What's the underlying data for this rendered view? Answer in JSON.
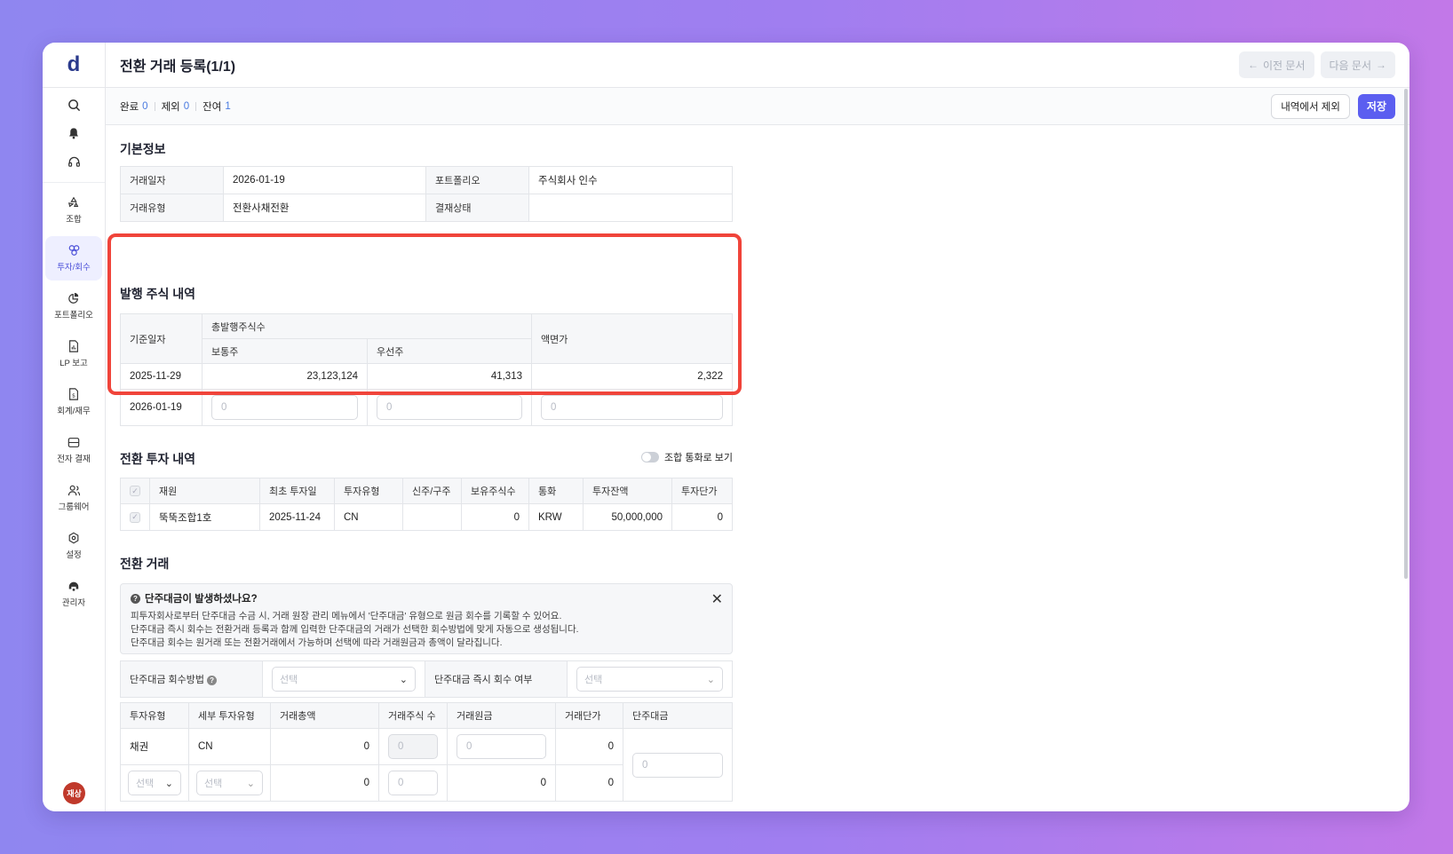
{
  "sidebar": {
    "logo": "d",
    "items": [
      {
        "label": "조합",
        "icon": "recycle-icon"
      },
      {
        "label": "투자/회수",
        "icon": "investment-icon",
        "active": true
      },
      {
        "label": "포트폴리오",
        "icon": "pie-chart-icon"
      },
      {
        "label": "LP 보고",
        "icon": "report-icon"
      },
      {
        "label": "회계/재무",
        "icon": "accounting-icon"
      },
      {
        "label": "전자 결재",
        "icon": "approval-icon"
      },
      {
        "label": "그룹웨어",
        "icon": "groupware-icon"
      },
      {
        "label": "설정",
        "icon": "settings-icon"
      },
      {
        "label": "관리자",
        "icon": "admin-icon"
      }
    ],
    "avatar": "재상"
  },
  "header": {
    "title": "전환 거래 등록(1/1)",
    "prev": "이전 문서",
    "next": "다음 문서"
  },
  "status": {
    "done_label": "완료",
    "done": "0",
    "excluded_label": "제외",
    "excluded": "0",
    "remaining_label": "잔여",
    "remaining": "1",
    "exclude_btn": "내역에서 제외",
    "save_btn": "저장"
  },
  "basic": {
    "title": "기본정보",
    "date_label": "거래일자",
    "date": "2026-01-19",
    "portfolio_label": "포트폴리오",
    "portfolio": "주식회사 인수",
    "type_label": "거래유형",
    "type": "전환사채전환",
    "approval_label": "결재상태",
    "approval": ""
  },
  "issued": {
    "title": "발행 주식 내역",
    "col_date": "기준일자",
    "col_total": "총발행주식수",
    "col_common": "보통주",
    "col_preferred": "우선주",
    "col_par": "액면가",
    "row1": {
      "date": "2025-11-29",
      "common": "23,123,124",
      "preferred": "41,313",
      "par": "2,322"
    },
    "row2": {
      "date": "2026-01-19",
      "common_ph": "0",
      "preferred_ph": "0",
      "par_ph": "0"
    }
  },
  "conv_invest": {
    "title": "전환 투자 내역",
    "toggle_label": "조합 통화로 보기",
    "headers": [
      "재원",
      "최초 투자일",
      "투자유형",
      "신주/구주",
      "보유주식수",
      "통화",
      "투자잔액",
      "투자단가"
    ],
    "row": {
      "fund": "뚝뚝조합1호",
      "first_date": "2025-11-24",
      "type": "CN",
      "new_old": "",
      "shares": "0",
      "currency": "KRW",
      "balance": "50,000,000",
      "unit": "0"
    }
  },
  "conv_trade": {
    "title": "전환 거래",
    "notice_title": "단주대금이 발생하셨나요?",
    "notice_lines": [
      "피투자회사로부터 단주대금 수금 시, 거래 원장 관리 메뉴에서 '단주대금' 유형으로 원금 회수를 기록할 수 있어요.",
      "단주대금 즉시 회수는 전환거래 등록과 함께 입력한 단주대금의 거래가 선택한 회수방법에 맞게 자동으로 생성됩니다.",
      "단주대금 회수는 원거래 또는 전환거래에서 가능하며 선택에 따라 거래원금과 총액이 달라집니다."
    ],
    "method_label": "단주대금 회수방법",
    "method_ph": "선택",
    "immediate_label": "단주대금 즉시 회수 여부",
    "immediate_ph": "선택",
    "headers": [
      "투자유형",
      "세부 투자유형",
      "거래총액",
      "거래주식 수",
      "거래원금",
      "거래단가",
      "단주대금"
    ],
    "row1": {
      "type": "채권",
      "sub": "CN",
      "total": "0",
      "shares_ph": "0",
      "principal_ph": "0",
      "unit": "0"
    },
    "row2": {
      "type_ph": "선택",
      "sub_ph": "선택",
      "total": "0",
      "shares_ph": "0",
      "principal": "0",
      "unit": "0"
    },
    "odd_ph": "0"
  }
}
